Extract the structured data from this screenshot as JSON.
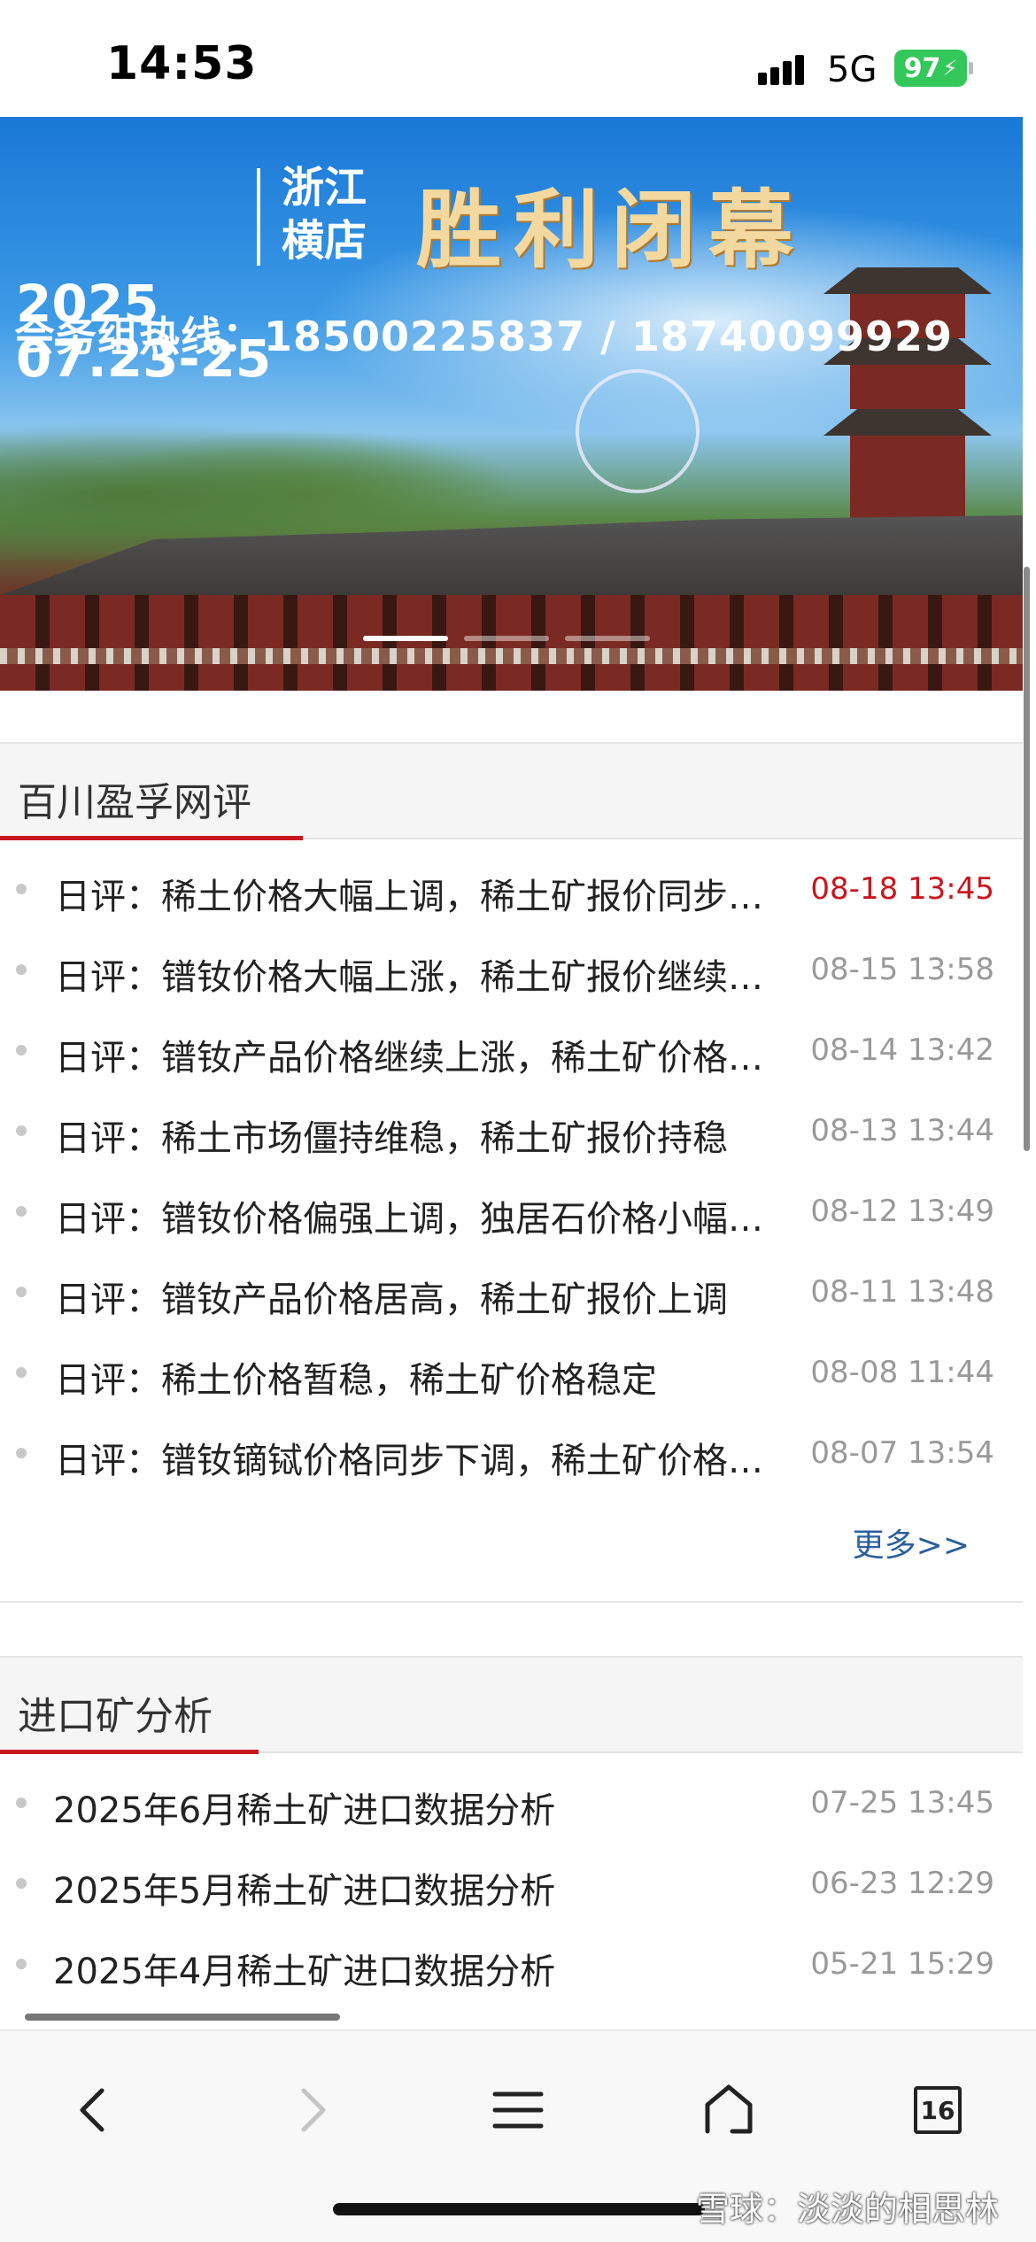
{
  "status_bar": {
    "time": "14:53",
    "network": "5G",
    "battery": "97"
  },
  "banner": {
    "year": "2025",
    "dates": "07.23-25",
    "province": "浙江",
    "town": "横店",
    "slogan": "胜利闭幕",
    "hotline": "会务组热线：18500225837 / 18740099929",
    "slide_count": 3,
    "active_slide": 1
  },
  "section_reviews": {
    "title": "百川盈孚网评",
    "more_label": "更多>>",
    "items": [
      {
        "title": "日评：稀土价格大幅上调，稀土矿报价同步上调",
        "date": "08-18 13:45",
        "recent": true
      },
      {
        "title": "日评：镨钕价格大幅上涨，稀土矿报价继续上调",
        "date": "08-15 13:58",
        "recent": false
      },
      {
        "title": "日评：镨钕产品价格继续上涨，稀土矿价格上调",
        "date": "08-14 13:42",
        "recent": false
      },
      {
        "title": "日评：稀土市场僵持维稳，稀土矿报价持稳",
        "date": "08-13 13:44",
        "recent": false
      },
      {
        "title": "日评：镨钕价格偏强上调，独居石价格小幅上调",
        "date": "08-12 13:49",
        "recent": false
      },
      {
        "title": "日评：镨钕产品价格居高，稀土矿报价上调",
        "date": "08-11 13:48",
        "recent": false
      },
      {
        "title": "日评：稀土价格暂稳，稀土矿价格稳定",
        "date": "08-08 11:44",
        "recent": false
      },
      {
        "title": "日评：镨钕镝铽价格同步下调，稀土矿价格下调",
        "date": "08-07 13:54",
        "recent": false
      }
    ]
  },
  "section_import": {
    "title": "进口矿分析",
    "items": [
      {
        "title": "2025年6月稀土矿进口数据分析",
        "date": "07-25 13:45"
      },
      {
        "title": "2025年5月稀土矿进口数据分析",
        "date": "06-23 12:29"
      },
      {
        "title": "2025年4月稀土矿进口数据分析",
        "date": "05-21 15:29"
      }
    ]
  },
  "toolbar": {
    "back_icon": "chevron-left-icon",
    "forward_icon": "chevron-right-icon",
    "menu_icon": "hamburger-menu-icon",
    "home_icon": "home-icon",
    "tabs_count": "16"
  },
  "watermark": "雪球：淡淡的相思林",
  "colors": {
    "accent_red": "#c8161d",
    "link_blue": "#2a5f9e",
    "battery_green": "#34c759"
  }
}
